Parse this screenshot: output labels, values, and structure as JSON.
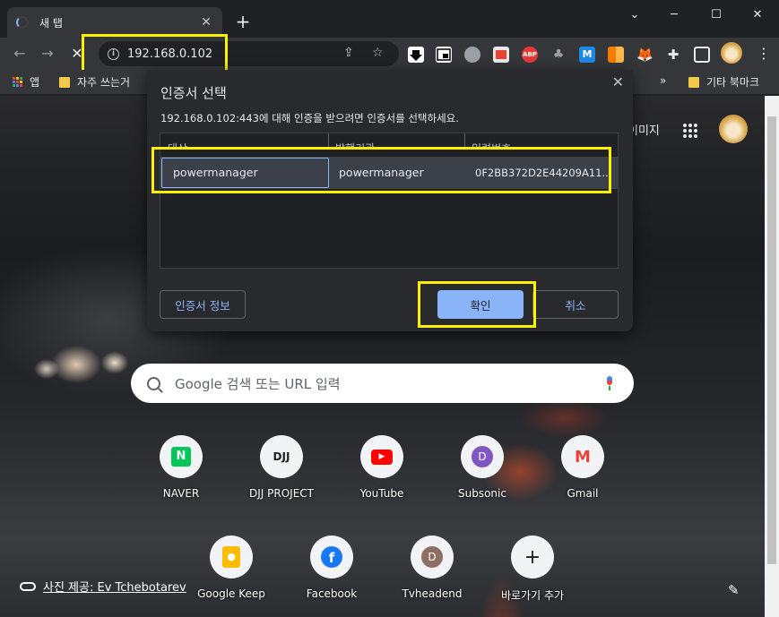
{
  "browser": {
    "tab_title": "새 탭",
    "tab_close": "✕",
    "new_tab": "+",
    "window_controls": {
      "chevron": "⌄",
      "minimize": "─",
      "maximize": "☐",
      "close": "✕"
    },
    "nav": {
      "back": "←",
      "forward": "→",
      "stop": "✕"
    },
    "address": "192.168.0.102",
    "menu": "⋮",
    "icons": [
      "download-icon",
      "picture-in-picture-icon",
      "camera-icon",
      "pdf-icon",
      "abp-icon",
      "puzzle-icon",
      "m-icon",
      "office-icon",
      "metamask-fox-icon",
      "extensions-icon",
      "sidebar-icon",
      "doge-avatar-icon"
    ],
    "abp_label": "ABP"
  },
  "bookmarks": {
    "apps_label": "앱",
    "first_folder": "자주 쓰는거",
    "overflow": "»",
    "other": "기타 북마크"
  },
  "ntp": {
    "images_link": "이미지",
    "search_placeholder": "Google 검색 또는 URL 입력",
    "shortcuts": [
      {
        "label": "NAVER",
        "glyph": "N"
      },
      {
        "label": "DJJ PROJECT",
        "glyph": "DJJ"
      },
      {
        "label": "YouTube",
        "glyph": "▶"
      },
      {
        "label": "Subsonic",
        "glyph": "D"
      },
      {
        "label": "Gmail",
        "glyph": "M"
      },
      {
        "label": "Google Keep",
        "glyph": "💡"
      },
      {
        "label": "Facebook",
        "glyph": "f"
      },
      {
        "label": "Tvheadend",
        "glyph": "D"
      },
      {
        "label": "바로가기 추가",
        "glyph": "+"
      }
    ],
    "photo_credit": "사진 제공: Ev Tchebotarev",
    "customize_icon": "✎"
  },
  "dialog": {
    "title": "인증서 선택",
    "close": "✕",
    "description": "192.168.0.102:443에 대해 인증을 받으려면 인증서를 선택하세요.",
    "columns": [
      "대상",
      "발행기관",
      "일련번호"
    ],
    "rows": [
      {
        "subject": "powermanager",
        "issuer": "powermanager",
        "serial": "0F2BB372D2E44209A11..."
      }
    ],
    "cert_info_button": "인증서 정보",
    "ok_button": "확인",
    "cancel_button": "취소"
  },
  "colors": {
    "highlight": "#fff000",
    "accent": "#8ab4f8",
    "dialog_bg": "#292a2d",
    "selected_row": "#3b4049"
  }
}
